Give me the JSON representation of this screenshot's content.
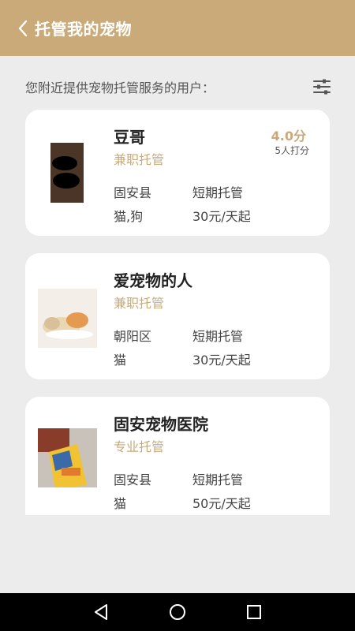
{
  "header": {
    "title": "托管我的宠物"
  },
  "subtitle": "您附近提供宠物托管服务的用户：",
  "colors": {
    "brand": "#c9aa78",
    "background": "#ececec",
    "card": "#ffffff"
  },
  "cards": [
    {
      "name": "豆哥",
      "type": "兼职托管",
      "location": "固安县",
      "service": "短期托管",
      "pets": "猫,狗",
      "price": "30元/天起",
      "score": "4.0分",
      "raters": "5人打分"
    },
    {
      "name": "爱宠物的人",
      "type": "兼职托管",
      "location": "朝阳区",
      "service": "短期托管",
      "pets": "猫",
      "price": "30元/天起"
    },
    {
      "name": "固安宠物医院",
      "type": "专业托管",
      "location": "固安县",
      "service": "短期托管",
      "pets": "猫",
      "price": "50元/天起"
    }
  ],
  "icons": {
    "back": "chevron-left-icon",
    "filter": "sliders-icon",
    "nav_back": "triangle-back-icon",
    "nav_home": "circle-home-icon",
    "nav_recent": "square-recent-icon"
  }
}
